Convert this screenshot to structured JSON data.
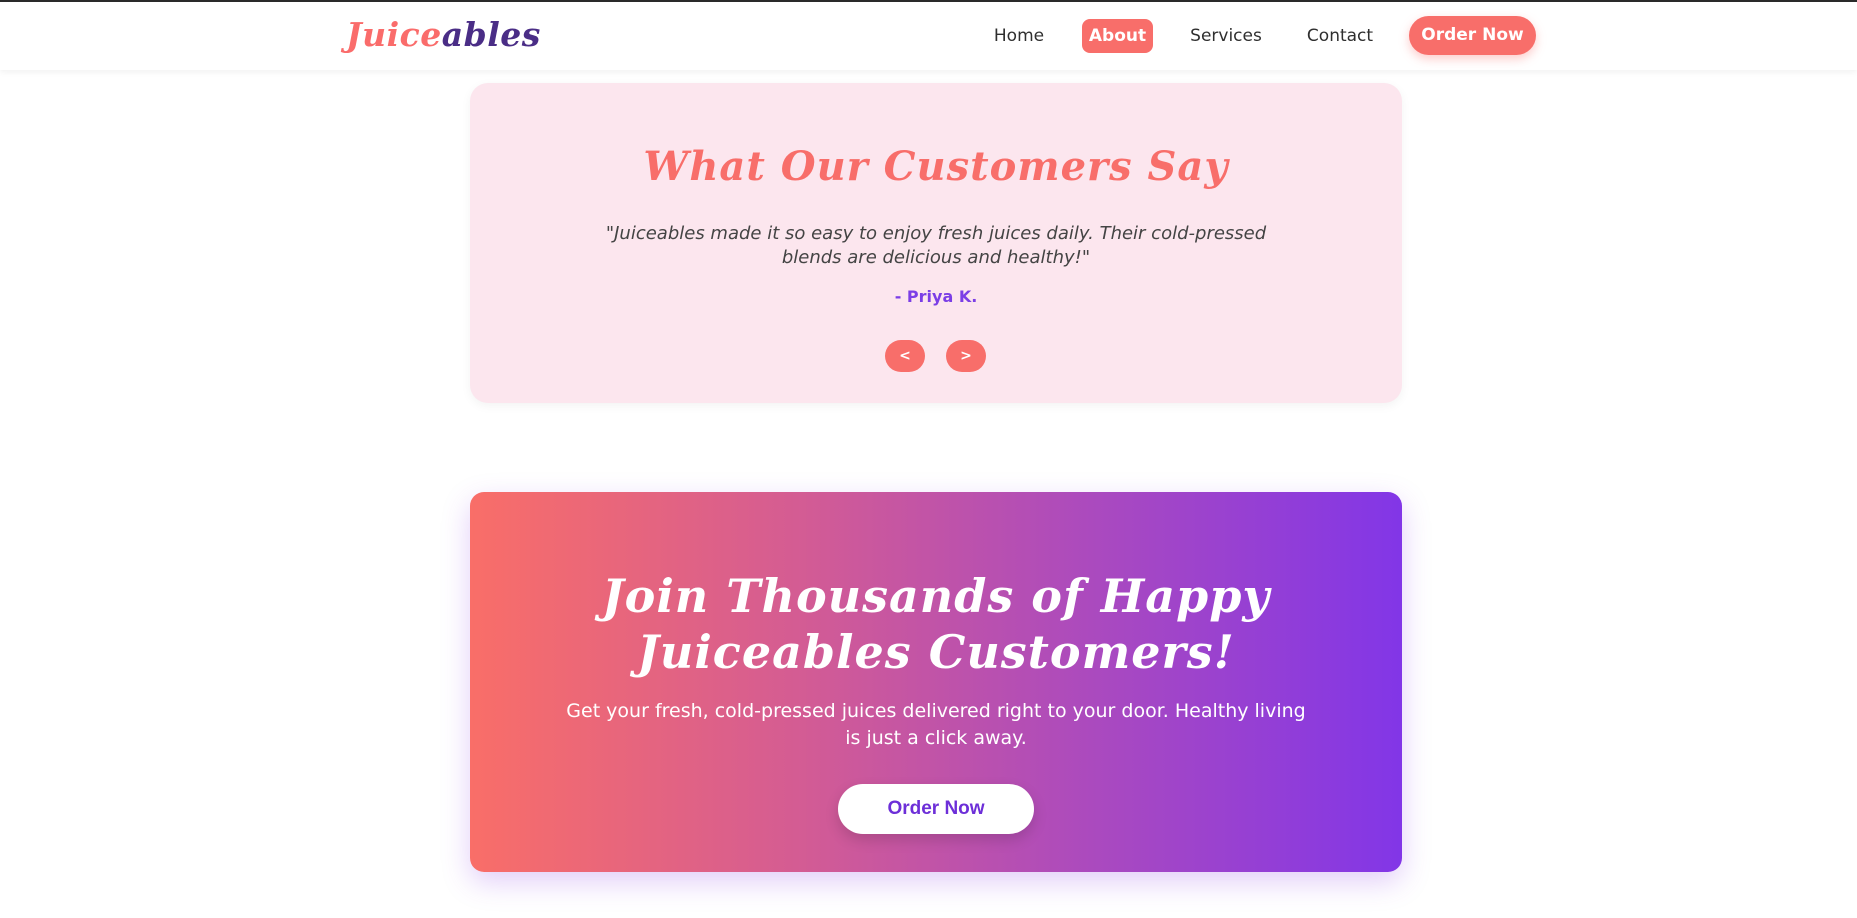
{
  "header": {
    "logo_part1": "Juice",
    "logo_part2": "ables",
    "nav": {
      "home": "Home",
      "about": "About",
      "services": "Services",
      "contact": "Contact"
    },
    "order_button": "Order Now"
  },
  "testimonials": {
    "title": "What Our Customers Say",
    "quote": "\"Juiceables made it so easy to enjoy fresh juices daily. Their cold-pressed blends are delicious and healthy!\"",
    "author": "- Priya K.",
    "prev_label": "<",
    "next_label": ">"
  },
  "cta": {
    "title_line1": "Join Thousands of Happy",
    "title_line2": "Juiceables Customers!",
    "text": "Get your fresh, cold-pressed juices delivered right to your door. Healthy living is just a click away.",
    "button": "Order Now"
  },
  "colors": {
    "accent": "#f86e6a",
    "brand_purple": "#4a2d86",
    "violet": "#8236e7",
    "testimonial_bg": "#fce6ee"
  }
}
